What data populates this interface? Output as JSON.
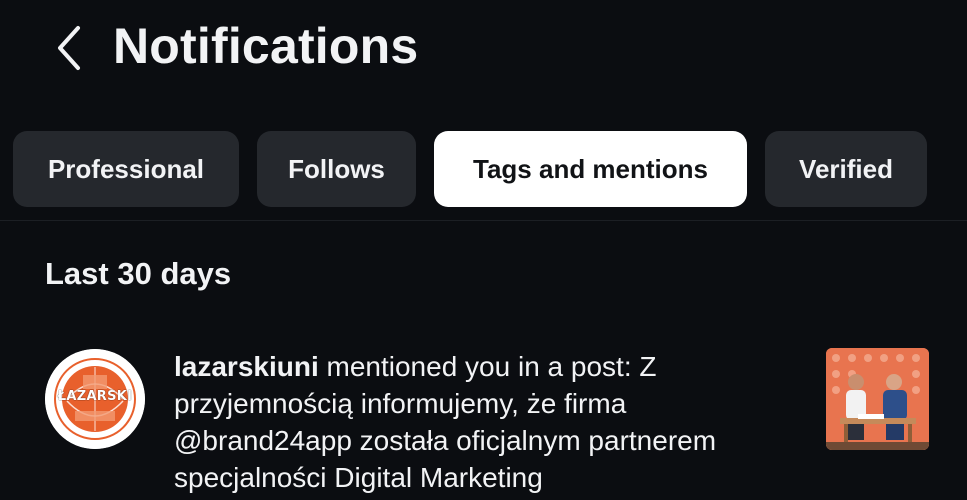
{
  "header": {
    "back_icon": "chevron-left-icon",
    "title": "Notifications"
  },
  "tabs": [
    {
      "label": "Professional",
      "active": false
    },
    {
      "label": "Follows",
      "active": false
    },
    {
      "label": "Tags and mentions",
      "active": true
    },
    {
      "label": "Verified",
      "active": false
    }
  ],
  "section": {
    "heading": "Last 30 days"
  },
  "notification": {
    "username": "lazarskiuni",
    "message": " mentioned you in a post: Z przyjemnością informujemy, że firma @brand24app została oficjalnym partnerem specjalności Digital Marketing",
    "avatar_logo_text": "ŁAZARSKI",
    "thumbnail_icon": "post-thumbnail-photo"
  },
  "colors": {
    "background": "#0b0d11",
    "tab_bg": "#25282d",
    "tab_active_bg": "#ffffff",
    "text": "#f2f3f5",
    "brand_orange": "#e8602c"
  }
}
